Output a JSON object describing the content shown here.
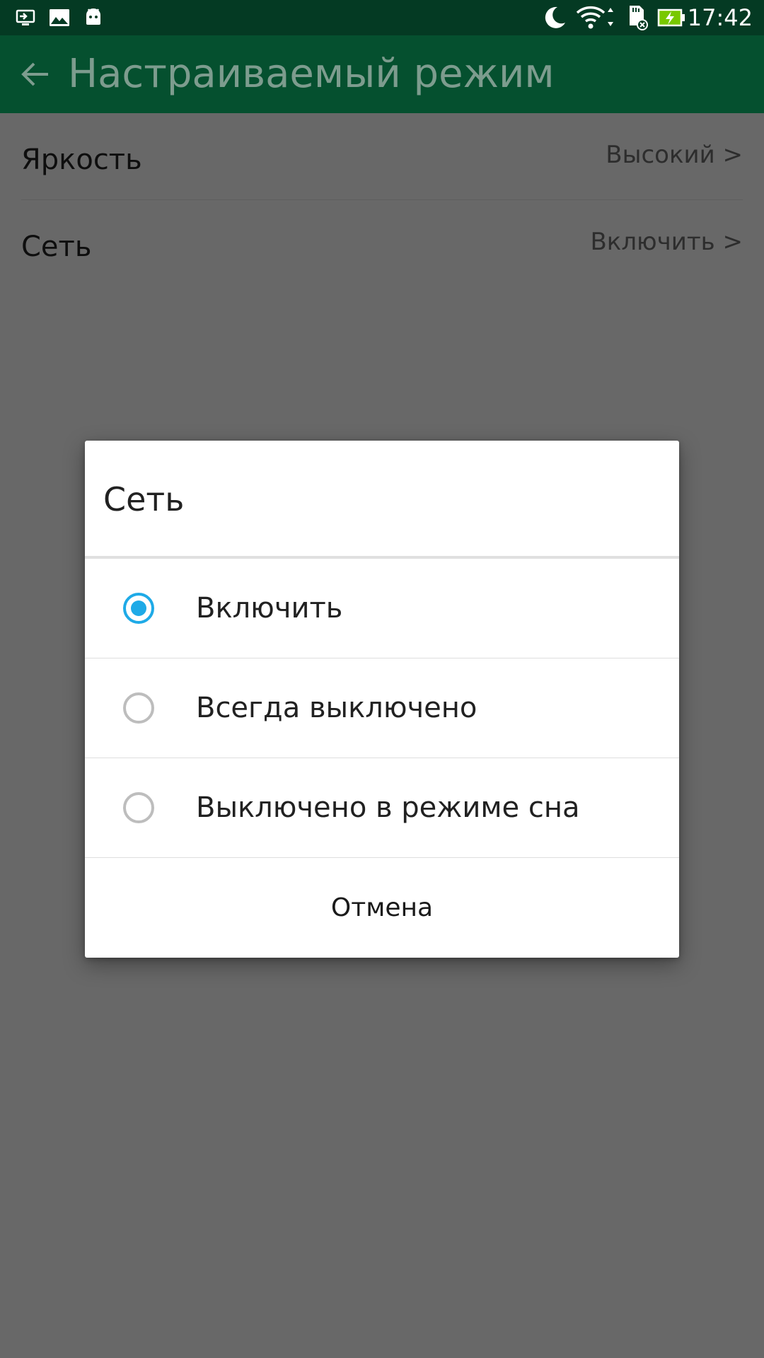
{
  "status_bar": {
    "time": "17:42",
    "icons": [
      "screen-cast-icon",
      "image-icon",
      "android-icon",
      "moon-icon",
      "wifi-icon",
      "sd-card-icon",
      "battery-charging-icon"
    ]
  },
  "app_bar": {
    "title": "Настраиваемый режим",
    "back_icon": "arrow-left-icon"
  },
  "settings": {
    "items": [
      {
        "label": "Яркость",
        "value": "Высокий >"
      },
      {
        "label": "Сеть",
        "value": "Включить >"
      }
    ]
  },
  "dialog": {
    "title": "Сеть",
    "options": [
      {
        "label": "Включить",
        "selected": true
      },
      {
        "label": "Всегда выключено",
        "selected": false
      },
      {
        "label": "Выключено в режиме сна",
        "selected": false
      }
    ],
    "cancel_label": "Отмена"
  },
  "colors": {
    "status_bar": "#043a23",
    "app_bar": "#05502f",
    "scrim_background": "#686868",
    "radio_selected": "#1eaae7",
    "radio_unselected": "#bdbdbd"
  }
}
